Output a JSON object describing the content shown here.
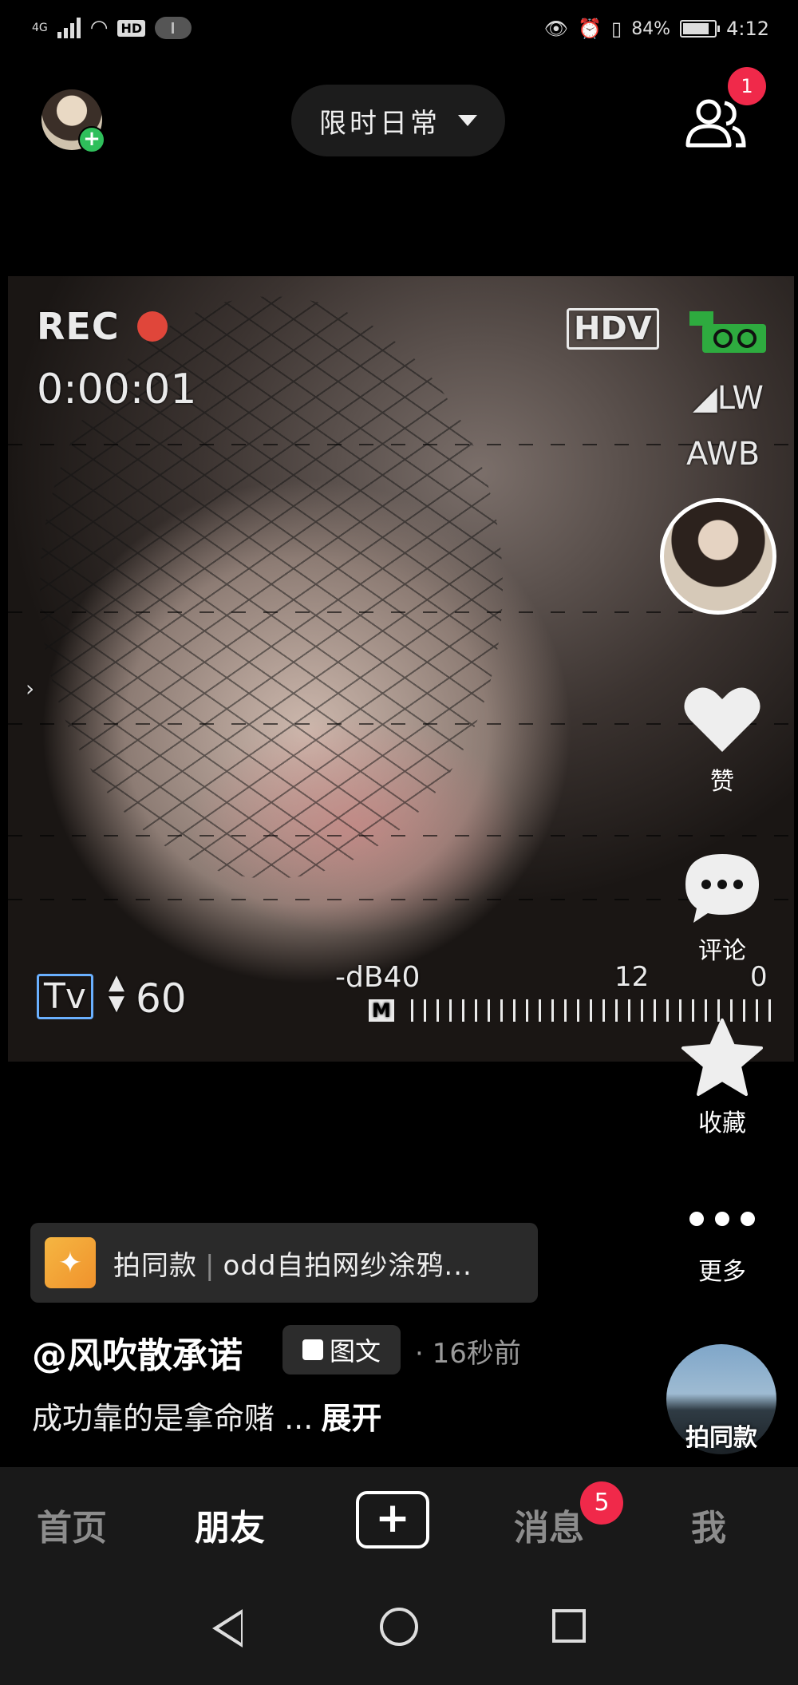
{
  "status_bar": {
    "network": "4G",
    "hd": "HD",
    "battery": "84%",
    "battery_level": 0.84,
    "time": "4:12"
  },
  "header": {
    "topic": "限时日常",
    "friends_badge": "1"
  },
  "photo_overlay": {
    "rec": "REC",
    "timecode": "0:00:01",
    "hdv": "HDV",
    "lw": "LW",
    "awb": "AWB",
    "tv": "Tv",
    "shutter": "60",
    "db": "-dB40",
    "db12": "12",
    "db0": "0",
    "meter_label": "M"
  },
  "rail": {
    "like": "赞",
    "comment": "评论",
    "favorite": "收藏",
    "more": "更多",
    "same_style": "拍同款"
  },
  "post": {
    "template_prefix": "拍同款",
    "template_name": "odd自拍网纱涂鸦...",
    "author": "@风吹散承诺",
    "type": "图文",
    "time_ago": "· 16秒前",
    "caption": "成功靠的是拿命赌 ...",
    "expand": "展开"
  },
  "tabs": {
    "home": "首页",
    "friends": "朋友",
    "plus": "+",
    "messages": "消息",
    "messages_badge": "5",
    "me": "我"
  },
  "colors": {
    "accent_red": "#f0294a",
    "online_green": "#2fbf5b",
    "tab_bg": "#191919"
  }
}
